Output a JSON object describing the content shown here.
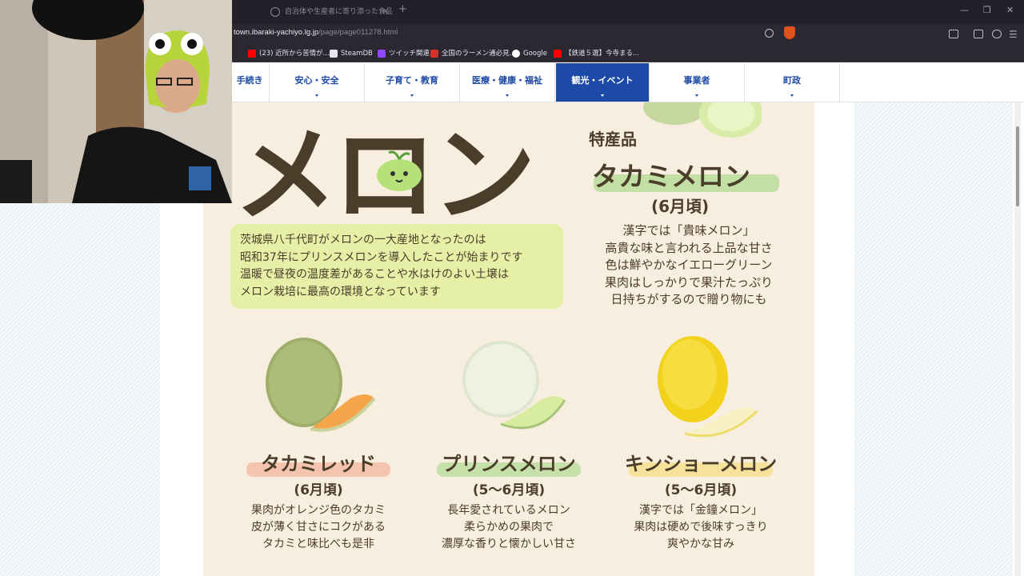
{
  "browser": {
    "tab_title": "自治体や生産者に寄り添った食品開発",
    "url_host": "town.ibaraki-yachiyo.lg.jp",
    "url_path": "/page/page011278.html",
    "bookmarks": [
      {
        "label": "(23) 近所から苦情が...",
        "icon_color": "#ff0000"
      },
      {
        "label": "SteamDB",
        "icon_color": "#e6e3ec"
      },
      {
        "label": "ツイッチ関連",
        "icon_color": "#9146ff"
      },
      {
        "label": "全国のラーメン通必見...",
        "icon_color": "#d9302a"
      },
      {
        "label": "Google",
        "icon_color": "#ffffff"
      },
      {
        "label": "【鉄道５選】今寺まる...",
        "icon_color": "#ff0000"
      }
    ]
  },
  "nav": {
    "items": [
      {
        "label": "手続き"
      },
      {
        "label": "安心・安全"
      },
      {
        "label": "子育て・教育"
      },
      {
        "label": "医療・健康・福祉"
      },
      {
        "label": "観光・イベント"
      },
      {
        "label": "事業者"
      },
      {
        "label": "町政"
      }
    ],
    "active_color": "#1c4aa6"
  },
  "poster": {
    "big_title": "メロン",
    "tokusan": "特産品",
    "featured": {
      "name": "タカミメロン",
      "season": "(6月頃)",
      "desc": [
        "漢字では「貴味メロン」",
        "高貴な味と言われる上品な甘さ",
        "色は鮮やかなイエローグリーン",
        "果肉はしっかりで果汁たっぷり",
        "日持ちがするので贈り物にも"
      ]
    },
    "intro": [
      "茨城県八千代町がメロンの一大産地となったのは",
      "昭和37年にプリンスメロンを導入したことが始まりです",
      "温暖で昼夜の温度差があることや水はけのよい土壌は",
      "メロン栽培に最高の環境となっています"
    ],
    "melons": [
      {
        "name": "タカミレッド",
        "season": "(6月頃)",
        "desc": [
          "果肉がオレンジ色のタカミ",
          "皮が薄く甘さにコクがある",
          "タカミと味比べも是非"
        ],
        "highlight": "#f3b9a2"
      },
      {
        "name": "プリンスメロン",
        "season": "(5～6月頃)",
        "desc": [
          "長年愛されているメロン",
          "柔らかめの果肉で",
          "濃厚な香りと懐かしい甘さ"
        ],
        "highlight": "#b8dc9a"
      },
      {
        "name": "キンショーメロン",
        "season": "(5～6月頃)",
        "desc": [
          "漢字では「金鐘メロン」",
          "果肉は硬めで後味すっきり",
          "爽やかな甘み"
        ],
        "highlight": "#f6df8a"
      }
    ]
  }
}
